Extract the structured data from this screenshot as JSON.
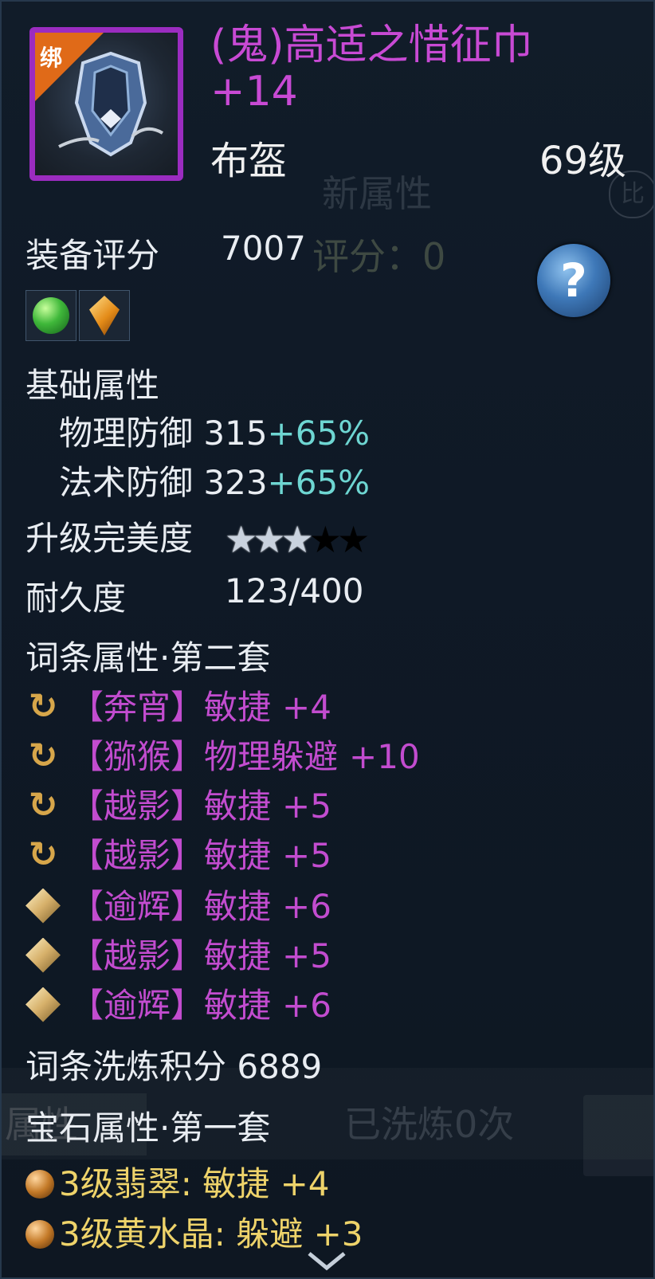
{
  "background_ui": {
    "new_attr": "新属性",
    "compare": "比",
    "score_hint": "评分：0",
    "attr_tab": "属性",
    "washed": "已洗炼0次"
  },
  "item": {
    "bind_tag": "绑",
    "name": "(鬼)高适之惜征巾 +14",
    "type": "布盔",
    "level": "69级",
    "name_color": "#c84ad4",
    "frame_color": "#9b2cc0"
  },
  "score": {
    "label": "装备评分",
    "value": "7007"
  },
  "help": "?",
  "base": {
    "title": "基础属性",
    "stats": [
      {
        "label": "物理防御",
        "value": "315",
        "bonus": "+65%"
      },
      {
        "label": "法术防御",
        "value": "323",
        "bonus": "+65%"
      }
    ]
  },
  "perfection": {
    "label": "升级完美度",
    "stars_filled": 3,
    "stars_total": 5
  },
  "durability": {
    "label": "耐久度",
    "value": "123/400"
  },
  "affixes": {
    "title": "词条属性·第二套",
    "items": [
      {
        "icon": "cycle-icon",
        "name": "【奔宵】",
        "attr": "敏捷",
        "value": "+4"
      },
      {
        "icon": "cycle-icon",
        "name": "【猕猴】",
        "attr": "物理躲避",
        "value": "+10"
      },
      {
        "icon": "cycle-icon",
        "name": "【越影】",
        "attr": "敏捷",
        "value": "+5"
      },
      {
        "icon": "cycle-icon",
        "name": "【越影】",
        "attr": "敏捷",
        "value": "+5"
      },
      {
        "icon": "diamond-icon",
        "name": "【逾辉】",
        "attr": "敏捷",
        "value": "+6"
      },
      {
        "icon": "diamond-icon",
        "name": "【越影】",
        "attr": "敏捷",
        "value": "+5"
      },
      {
        "icon": "diamond-icon",
        "name": "【逾辉】",
        "attr": "敏捷",
        "value": "+6"
      }
    ]
  },
  "wash_score": {
    "label": "词条洗炼积分",
    "value": "6889"
  },
  "gems": {
    "title": "宝石属性·第一套",
    "items": [
      {
        "text": "3级翡翠: 敏捷 +4"
      },
      {
        "text": "3级黄水晶: 躲避 +3"
      }
    ]
  }
}
